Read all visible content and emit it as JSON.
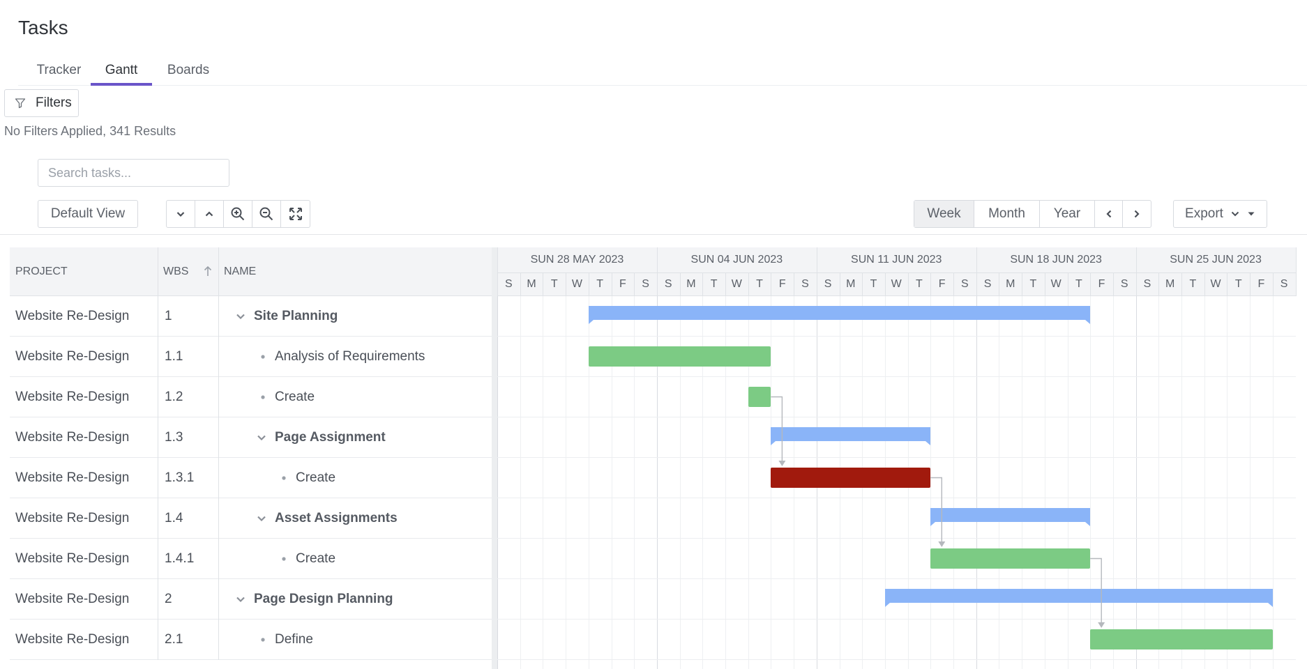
{
  "page": {
    "title": "Tasks"
  },
  "tabs": [
    {
      "label": "Tracker",
      "active": false
    },
    {
      "label": "Gantt",
      "active": true
    },
    {
      "label": "Boards",
      "active": false
    }
  ],
  "filters": {
    "button_label": "Filters",
    "summary": "No Filters Applied, 341 Results"
  },
  "search": {
    "placeholder": "Search tasks..."
  },
  "toolbar": {
    "default_view_label": "Default View",
    "icons": [
      "chevron-down-icon",
      "chevron-up-icon",
      "zoom-in-icon",
      "zoom-out-icon",
      "fit-to-screen-icon"
    ],
    "ranges": [
      {
        "label": "Week",
        "active": true
      },
      {
        "label": "Month",
        "active": false
      },
      {
        "label": "Year",
        "active": false
      }
    ],
    "export_label": "Export"
  },
  "grid": {
    "columns": {
      "project": "PROJECT",
      "wbs": "WBS",
      "name": "NAME"
    },
    "sort_icon": "arrow-up-icon",
    "rows": [
      {
        "project": "Website Re-Design",
        "wbs": "1",
        "name": "Site Planning",
        "level": 0,
        "parent": true
      },
      {
        "project": "Website Re-Design",
        "wbs": "1.1",
        "name": "Analysis of Requirements",
        "level": 1,
        "parent": false
      },
      {
        "project": "Website Re-Design",
        "wbs": "1.2",
        "name": "Create",
        "level": 1,
        "parent": false
      },
      {
        "project": "Website Re-Design",
        "wbs": "1.3",
        "name": "Page Assignment",
        "level": 1,
        "parent": true
      },
      {
        "project": "Website Re-Design",
        "wbs": "1.3.1",
        "name": "Create",
        "level": 2,
        "parent": false
      },
      {
        "project": "Website Re-Design",
        "wbs": "1.4",
        "name": "Asset Assignments",
        "level": 1,
        "parent": true
      },
      {
        "project": "Website Re-Design",
        "wbs": "1.4.1",
        "name": "Create",
        "level": 2,
        "parent": false
      },
      {
        "project": "Website Re-Design",
        "wbs": "2",
        "name": "Page Design Planning",
        "level": 0,
        "parent": true
      },
      {
        "project": "Website Re-Design",
        "wbs": "2.1",
        "name": "Define",
        "level": 1,
        "parent": false
      }
    ]
  },
  "gantt": {
    "weeks": [
      "SUN 28 MAY 2023",
      "SUN 04 JUN 2023",
      "SUN 11 JUN 2023",
      "SUN 18 JUN 2023",
      "SUN 25 JUN 2023"
    ],
    "days": [
      "S",
      "M",
      "T",
      "W",
      "T",
      "F",
      "S"
    ],
    "colors": {
      "summary": "#8ab4f8",
      "task": "#7ccb84",
      "critical": "#a11a0d",
      "link": "#b5b8bd"
    },
    "bars": [
      {
        "row": 0,
        "type": "summary",
        "start": 4,
        "end": 26
      },
      {
        "row": 1,
        "type": "task",
        "start": 4,
        "end": 12
      },
      {
        "row": 2,
        "type": "task",
        "start": 11,
        "end": 12
      },
      {
        "row": 3,
        "type": "summary",
        "start": 12,
        "end": 19
      },
      {
        "row": 4,
        "type": "critical",
        "start": 12,
        "end": 19
      },
      {
        "row": 5,
        "type": "summary",
        "start": 19,
        "end": 26
      },
      {
        "row": 6,
        "type": "task",
        "start": 19,
        "end": 26
      },
      {
        "row": 7,
        "type": "summary",
        "start": 17,
        "end": 34
      },
      {
        "row": 8,
        "type": "task",
        "start": 26,
        "end": 34
      }
    ],
    "links": [
      {
        "from": 2,
        "to": 4
      },
      {
        "from": 4,
        "to": 6
      },
      {
        "from": 6,
        "to": 8
      }
    ]
  }
}
